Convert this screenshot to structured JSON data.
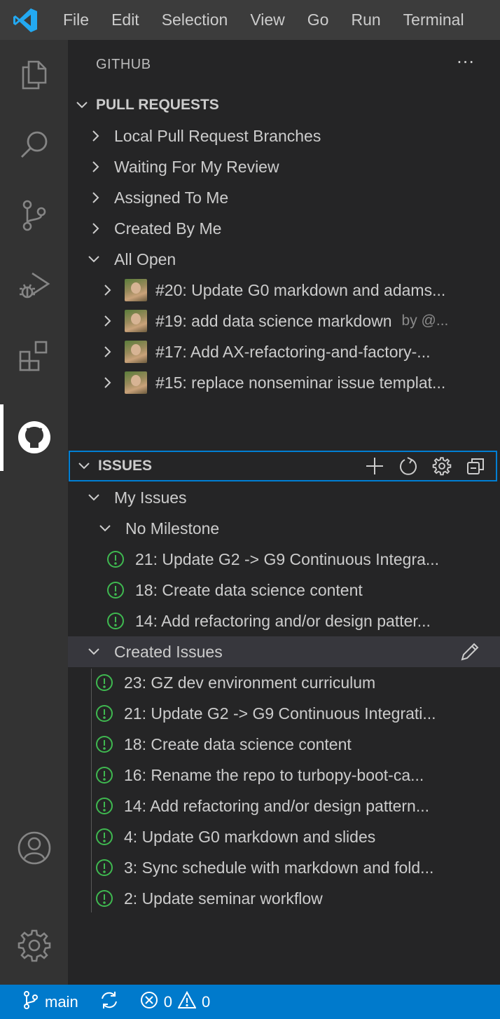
{
  "menubar": {
    "items": [
      "File",
      "Edit",
      "Selection",
      "View",
      "Go",
      "Run",
      "Terminal"
    ]
  },
  "activitybar": {
    "icons": [
      "explorer-icon",
      "search-icon",
      "source-control-icon",
      "run-debug-icon",
      "extensions-icon",
      "github-icon",
      "account-icon",
      "settings-gear-icon"
    ],
    "active": "github-icon"
  },
  "sidebar": {
    "title": "GITHUB",
    "more": "···"
  },
  "pull_requests": {
    "header": "PULL REQUESTS",
    "categories": [
      {
        "label": "Local Pull Request Branches",
        "expanded": false
      },
      {
        "label": "Waiting For My Review",
        "expanded": false
      },
      {
        "label": "Assigned To Me",
        "expanded": false
      },
      {
        "label": "Created By Me",
        "expanded": false
      },
      {
        "label": "All Open",
        "expanded": true
      }
    ],
    "all_open": [
      {
        "title": "#20: Update G0 markdown and adams...",
        "desc": ""
      },
      {
        "title": "#19: add data science markdown",
        "desc": "by @..."
      },
      {
        "title": "#17: Add AX-refactoring-and-factory-...",
        "desc": ""
      },
      {
        "title": "#15: replace nonseminar issue templat...",
        "desc": ""
      }
    ]
  },
  "issues": {
    "header": "ISSUES",
    "actions": [
      "add-icon",
      "refresh-icon",
      "gear-icon",
      "collapse-all-icon"
    ],
    "my_issues": {
      "label": "My Issues",
      "milestone": "No Milestone",
      "items": [
        "21: Update G2 -> G9 Continuous Integra...",
        "18: Create data science content",
        "14: Add refactoring and/or design patter..."
      ]
    },
    "created_issues": {
      "label": "Created Issues",
      "items": [
        "23: GZ dev environment curriculum",
        "21: Update G2 -> G9 Continuous Integrati...",
        "18: Create data science content",
        "16: Rename the repo to turbopy-boot-ca...",
        "14: Add refactoring and/or design pattern...",
        "4: Update G0 markdown and slides",
        "3: Sync schedule with markdown and fold...",
        "2: Update seminar workflow"
      ]
    }
  },
  "statusbar": {
    "branch": "main",
    "errors": "0",
    "warnings": "0"
  },
  "colors": {
    "accent": "#007acc",
    "focus_border": "#007fd4",
    "issue_open": "#3fb950",
    "activity_bg": "#333333",
    "sidebar_bg": "#252526",
    "menubar_bg": "#3c3c3c"
  }
}
